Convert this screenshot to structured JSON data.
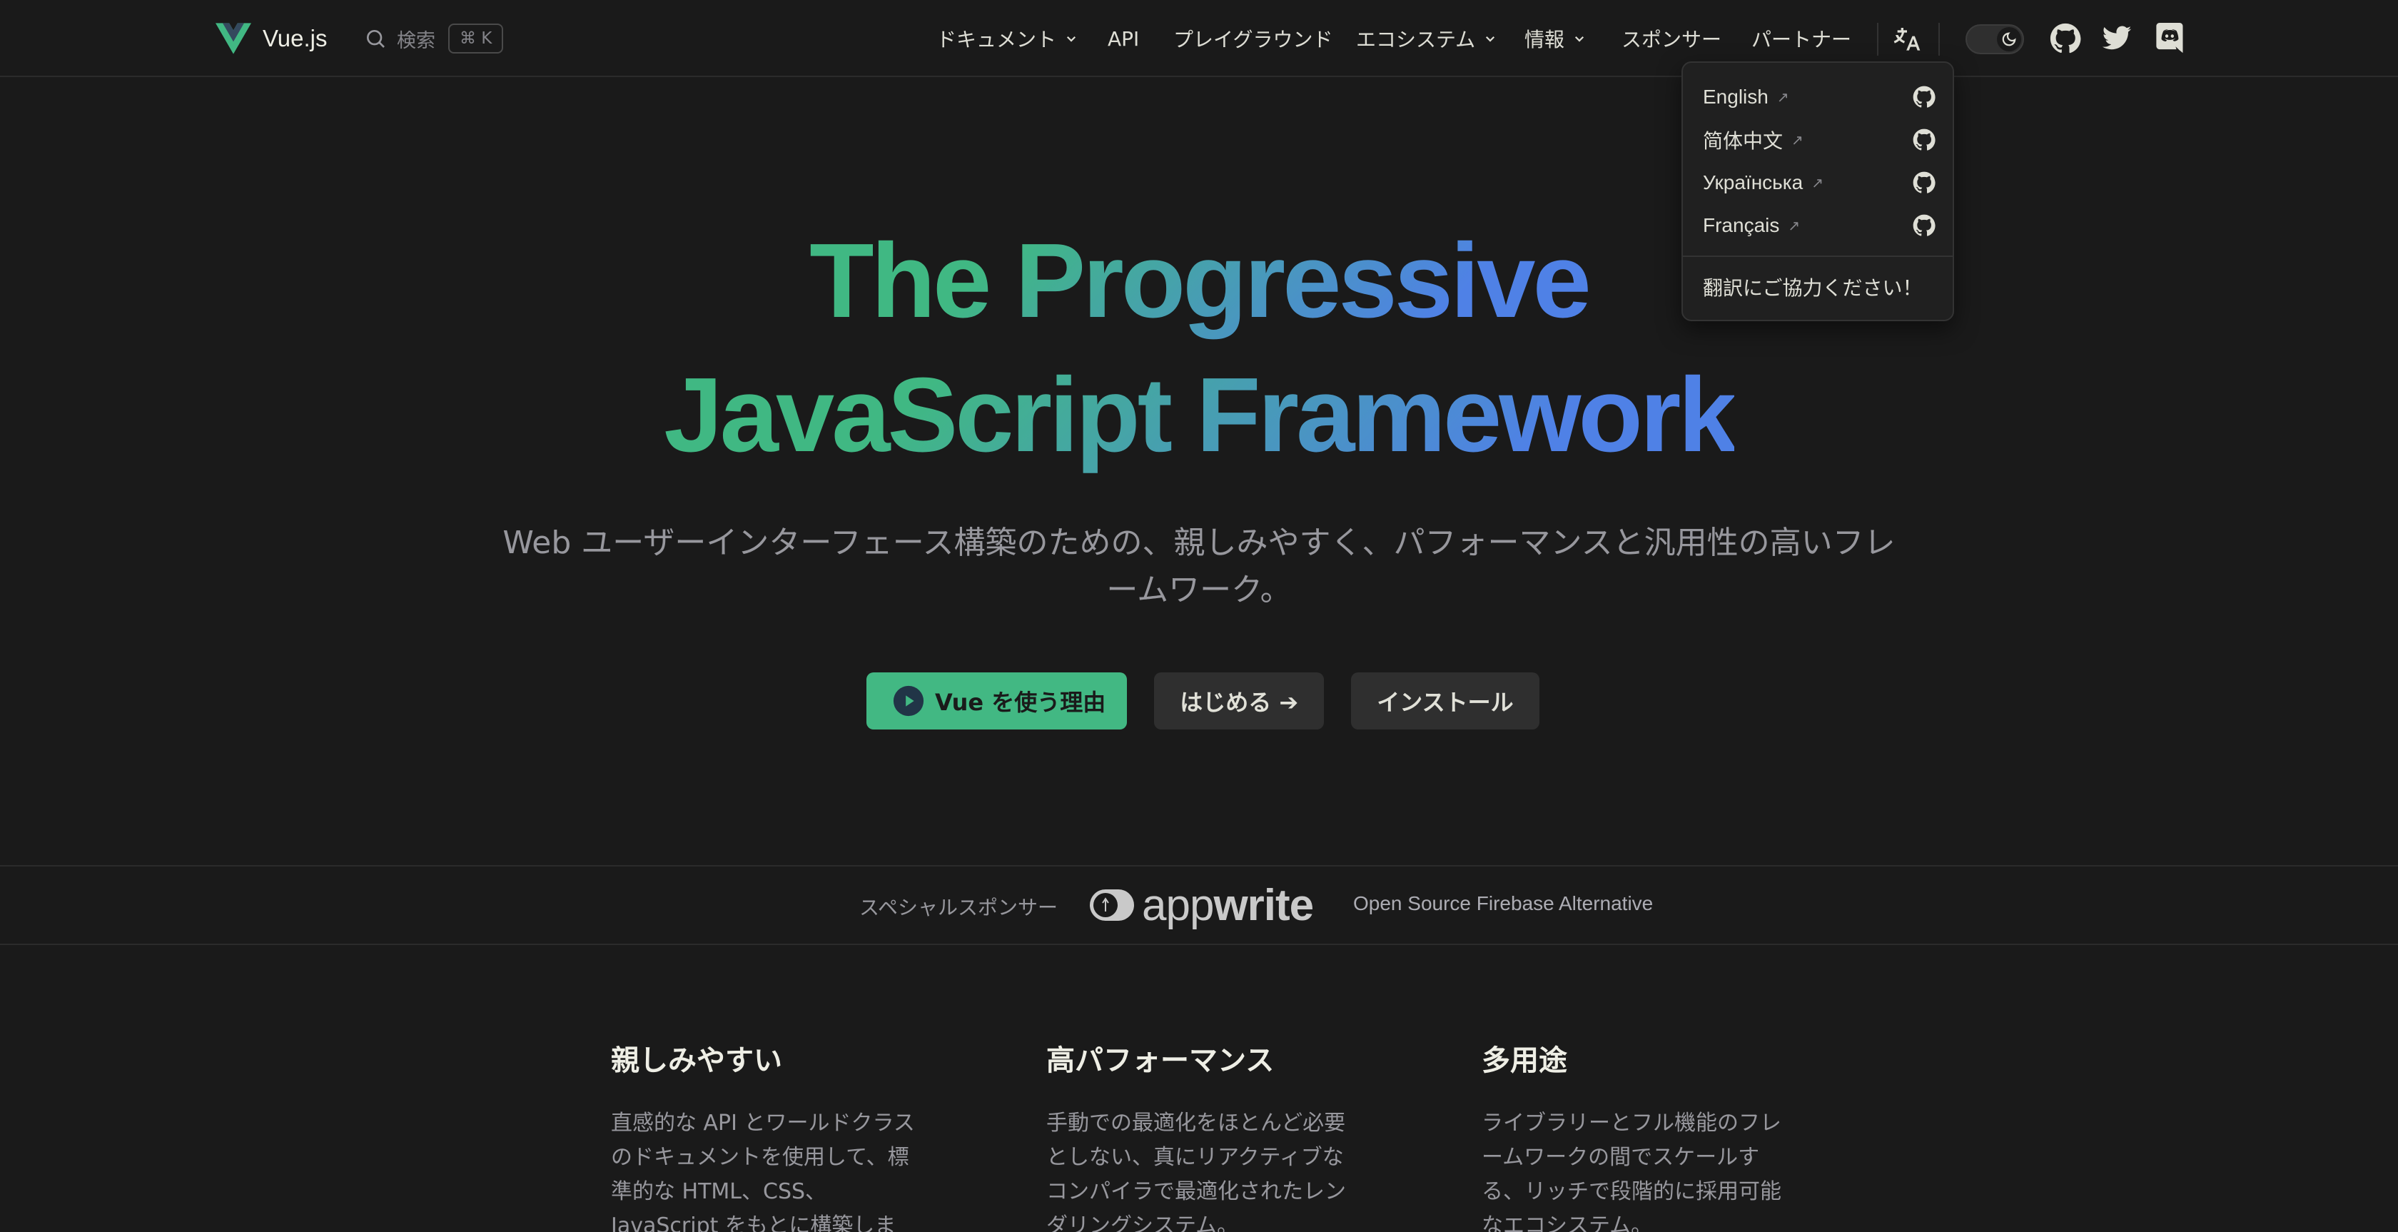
{
  "nav": {
    "logo_text": "Vue.js",
    "search_label": "検索",
    "search_shortcut": "⌘ K",
    "menu": [
      {
        "label": "ドキュメント",
        "has_dropdown": true
      },
      {
        "label": "API",
        "has_dropdown": false
      },
      {
        "label": "プレイグラウンド",
        "has_dropdown": false
      },
      {
        "label": "エコシステム",
        "has_dropdown": true
      },
      {
        "label": "情報",
        "has_dropdown": true
      },
      {
        "label": "スポンサー",
        "has_dropdown": false
      },
      {
        "label": "パートナー",
        "has_dropdown": false
      }
    ],
    "icons": [
      "translate-icon",
      "moon-icon",
      "github-icon",
      "twitter-icon",
      "discord-icon"
    ]
  },
  "translations_dropdown": {
    "items": [
      {
        "label": "English",
        "icon": "external-arrow"
      },
      {
        "label": "简体中文",
        "icon": "external-arrow"
      },
      {
        "label": "Українська",
        "icon": "external-arrow"
      },
      {
        "label": "Français",
        "icon": "external-arrow"
      }
    ],
    "help_link": "翻訳にご協力ください！"
  },
  "hero": {
    "tagline_line1": "The Progressive",
    "tagline_line2": "JavaScript Framework",
    "description": "Web ユーザーインターフェース構築のための、親しみやすく、パフォーマンスと汎用性の高いフレームワーク。",
    "buttons": {
      "why": "Vue を使う理由",
      "get_started": "はじめる ➔",
      "install": "インストール"
    }
  },
  "sponsor": {
    "label": "スペシャルスポンサー",
    "logo_light": "app",
    "logo_bold": "write",
    "tagline": "Open Source Firebase Alternative"
  },
  "features": [
    {
      "title": "親しみやすい",
      "text": "直感的な API とワールドクラスのドキュメントを使用して、標準的な HTML、CSS、JavaScript をもとに構築しま"
    },
    {
      "title": "高パフォーマンス",
      "text": "手動での最適化をほとんど必要としない、真にリアクティブなコンパイラで最適化されたレンダリングシステム。"
    },
    {
      "title": "多用途",
      "text": "ライブラリーとフル機能のフレームワークの間でスケールする、リッチで段階的に採用可能なエコシステム。"
    }
  ],
  "colors": {
    "background": "#1a1a1a",
    "brand_green": "#42b883",
    "gradient_blue": "#647eff"
  }
}
